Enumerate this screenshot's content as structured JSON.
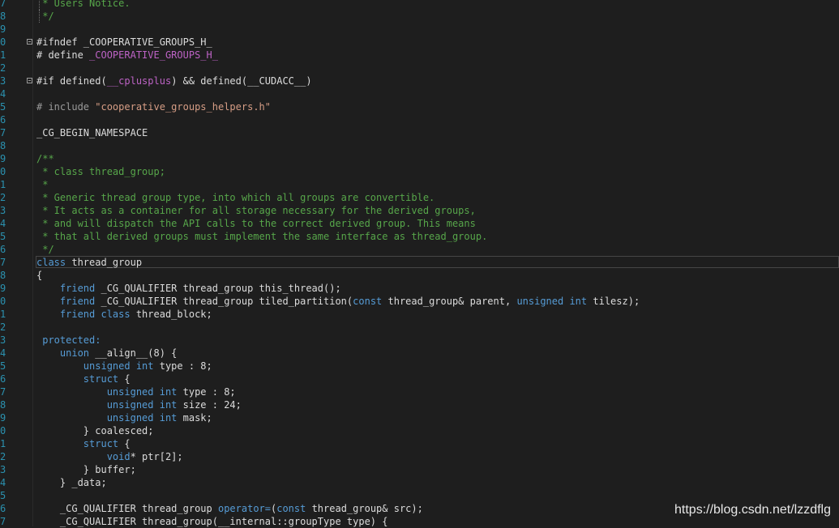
{
  "editor": {
    "lines": [
      {
        "n": "7",
        "segments": [
          {
            "t": " * Users Notice.",
            "c": "cm"
          }
        ]
      },
      {
        "n": "8",
        "segments": [
          {
            "t": " */",
            "c": "cm"
          }
        ]
      },
      {
        "n": "9",
        "segments": []
      },
      {
        "n": "0",
        "segments": [
          {
            "t": "#ifndef _COOPERATIVE_GROUPS_H_",
            "c": "id"
          }
        ]
      },
      {
        "n": "1",
        "segments": [
          {
            "t": "# define ",
            "c": "id"
          },
          {
            "t": "_COOPERATIVE_GROUPS_H_",
            "c": "mac"
          }
        ]
      },
      {
        "n": "2",
        "segments": []
      },
      {
        "n": "3",
        "segments": [
          {
            "t": "#if defined(",
            "c": "id"
          },
          {
            "t": "__cplusplus",
            "c": "mac"
          },
          {
            "t": ") && defined(__CUDACC__)",
            "c": "id"
          }
        ]
      },
      {
        "n": "4",
        "segments": []
      },
      {
        "n": "5",
        "segments": [
          {
            "t": "# include ",
            "c": "pp"
          },
          {
            "t": "\"cooperative_groups_helpers.h\"",
            "c": "str"
          }
        ]
      },
      {
        "n": "6",
        "segments": []
      },
      {
        "n": "7",
        "segments": [
          {
            "t": "_CG_BEGIN_NAMESPACE",
            "c": "id"
          }
        ]
      },
      {
        "n": "8",
        "segments": []
      },
      {
        "n": "9",
        "segments": [
          {
            "t": "/**",
            "c": "cm"
          }
        ]
      },
      {
        "n": "0",
        "segments": [
          {
            "t": " * class thread_group;",
            "c": "cm"
          }
        ]
      },
      {
        "n": "1",
        "segments": [
          {
            "t": " *",
            "c": "cm"
          }
        ]
      },
      {
        "n": "2",
        "segments": [
          {
            "t": " * Generic thread group type, into which all groups are convertible.",
            "c": "cm"
          }
        ]
      },
      {
        "n": "3",
        "segments": [
          {
            "t": " * It acts as a container for all storage necessary for the derived groups,",
            "c": "cm"
          }
        ]
      },
      {
        "n": "4",
        "segments": [
          {
            "t": " * and will dispatch the API calls to the correct derived group. This means",
            "c": "cm"
          }
        ]
      },
      {
        "n": "5",
        "segments": [
          {
            "t": " * that all derived groups must implement the same interface as thread_group.",
            "c": "cm"
          }
        ]
      },
      {
        "n": "6",
        "segments": [
          {
            "t": " */",
            "c": "cm"
          }
        ]
      },
      {
        "n": "7",
        "segments": [
          {
            "t": "class",
            "c": "kw"
          },
          {
            "t": " thread_group",
            "c": "id"
          }
        ]
      },
      {
        "n": "8",
        "segments": [
          {
            "t": "{",
            "c": "id"
          }
        ]
      },
      {
        "n": "9",
        "segments": [
          {
            "t": "    friend",
            "c": "kw"
          },
          {
            "t": " _CG_QUALIFIER thread_group this_thread();",
            "c": "id"
          }
        ]
      },
      {
        "n": "0",
        "segments": [
          {
            "t": "    friend",
            "c": "kw"
          },
          {
            "t": " _CG_QUALIFIER thread_group tiled_partition(",
            "c": "id"
          },
          {
            "t": "const",
            "c": "kw"
          },
          {
            "t": " thread_group& parent, ",
            "c": "id"
          },
          {
            "t": "unsigned int",
            "c": "kw"
          },
          {
            "t": " tilesz);",
            "c": "id"
          }
        ]
      },
      {
        "n": "1",
        "segments": [
          {
            "t": "    friend class",
            "c": "kw"
          },
          {
            "t": " thread_block;",
            "c": "id"
          }
        ]
      },
      {
        "n": "2",
        "segments": []
      },
      {
        "n": "3",
        "segments": [
          {
            "t": " protected:",
            "c": "kw"
          }
        ]
      },
      {
        "n": "4",
        "segments": [
          {
            "t": "    union",
            "c": "kw"
          },
          {
            "t": " __align__(8) {",
            "c": "id"
          }
        ]
      },
      {
        "n": "5",
        "segments": [
          {
            "t": "        unsigned int",
            "c": "kw"
          },
          {
            "t": " type : 8;",
            "c": "id"
          }
        ]
      },
      {
        "n": "6",
        "segments": [
          {
            "t": "        struct",
            "c": "kw"
          },
          {
            "t": " {",
            "c": "id"
          }
        ]
      },
      {
        "n": "7",
        "segments": [
          {
            "t": "            unsigned int",
            "c": "kw"
          },
          {
            "t": " type : 8;",
            "c": "id"
          }
        ]
      },
      {
        "n": "8",
        "segments": [
          {
            "t": "            unsigned int",
            "c": "kw"
          },
          {
            "t": " size : 24;",
            "c": "id"
          }
        ]
      },
      {
        "n": "9",
        "segments": [
          {
            "t": "            unsigned int",
            "c": "kw"
          },
          {
            "t": " mask;",
            "c": "id"
          }
        ]
      },
      {
        "n": "0",
        "segments": [
          {
            "t": "        } coalesced;",
            "c": "id"
          }
        ]
      },
      {
        "n": "1",
        "segments": [
          {
            "t": "        struct",
            "c": "kw"
          },
          {
            "t": " {",
            "c": "id"
          }
        ]
      },
      {
        "n": "2",
        "segments": [
          {
            "t": "            void",
            "c": "kw"
          },
          {
            "t": "* ptr[2];",
            "c": "id"
          }
        ]
      },
      {
        "n": "3",
        "segments": [
          {
            "t": "        } buffer;",
            "c": "id"
          }
        ]
      },
      {
        "n": "4",
        "segments": [
          {
            "t": "    } _data;",
            "c": "id"
          }
        ]
      },
      {
        "n": "5",
        "segments": []
      },
      {
        "n": "6",
        "segments": [
          {
            "t": "    _CG_QUALIFIER thread_group ",
            "c": "id"
          },
          {
            "t": "operator=",
            "c": "kw"
          },
          {
            "t": "(",
            "c": "id"
          },
          {
            "t": "const",
            "c": "kw"
          },
          {
            "t": " thread_group& src);",
            "c": "id"
          }
        ]
      },
      {
        "n": "7",
        "segments": [
          {
            "t": "    _CG_QUALIFIER thread_group(__internal::groupType type) {",
            "c": "id"
          }
        ]
      }
    ]
  },
  "watermark": {
    "text": "https://blog.csdn.net/lzzdflg"
  },
  "colors": {
    "keyword": "#569cd6",
    "comment": "#57a64a",
    "macro": "#bd63c5",
    "string": "#d69d85",
    "line_number": "#2b91af",
    "background": "#1e1e1e"
  }
}
